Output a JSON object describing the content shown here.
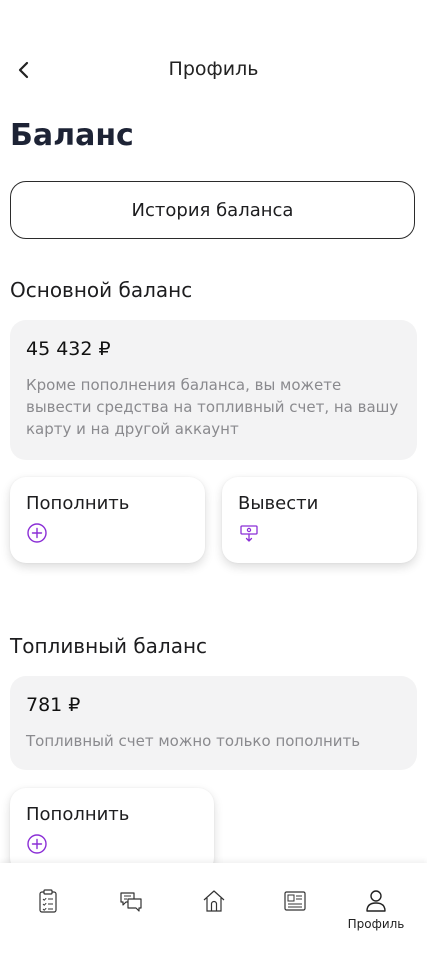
{
  "header": {
    "title": "Профиль"
  },
  "page": {
    "heading": "Баланс",
    "history_button": "История баланса"
  },
  "main_balance": {
    "section_title": "Основной баланс",
    "amount": "45 432 ₽",
    "description": "Кроме пополнения баланса, вы можете вывести средства на топливный счет, на вашу карту и на другой аккаунт",
    "actions": {
      "topup": "Пополнить",
      "withdraw": "Вывести"
    }
  },
  "fuel_balance": {
    "section_title": "Топливный баланс",
    "amount": "781 ₽",
    "description": "Топливный счет можно только пополнить",
    "actions": {
      "topup": "Пополнить"
    }
  },
  "tabbar": {
    "items": [
      {
        "icon": "clipboard-list-icon",
        "label": ""
      },
      {
        "icon": "chat-bubbles-icon",
        "label": ""
      },
      {
        "icon": "home-icon",
        "label": ""
      },
      {
        "icon": "newspaper-icon",
        "label": ""
      },
      {
        "icon": "user-icon",
        "label": "Профиль",
        "active": true
      }
    ]
  },
  "colors": {
    "accent": "#8b2fd6",
    "card_bg": "#f3f3f4",
    "text_muted": "#8a8a8e"
  }
}
